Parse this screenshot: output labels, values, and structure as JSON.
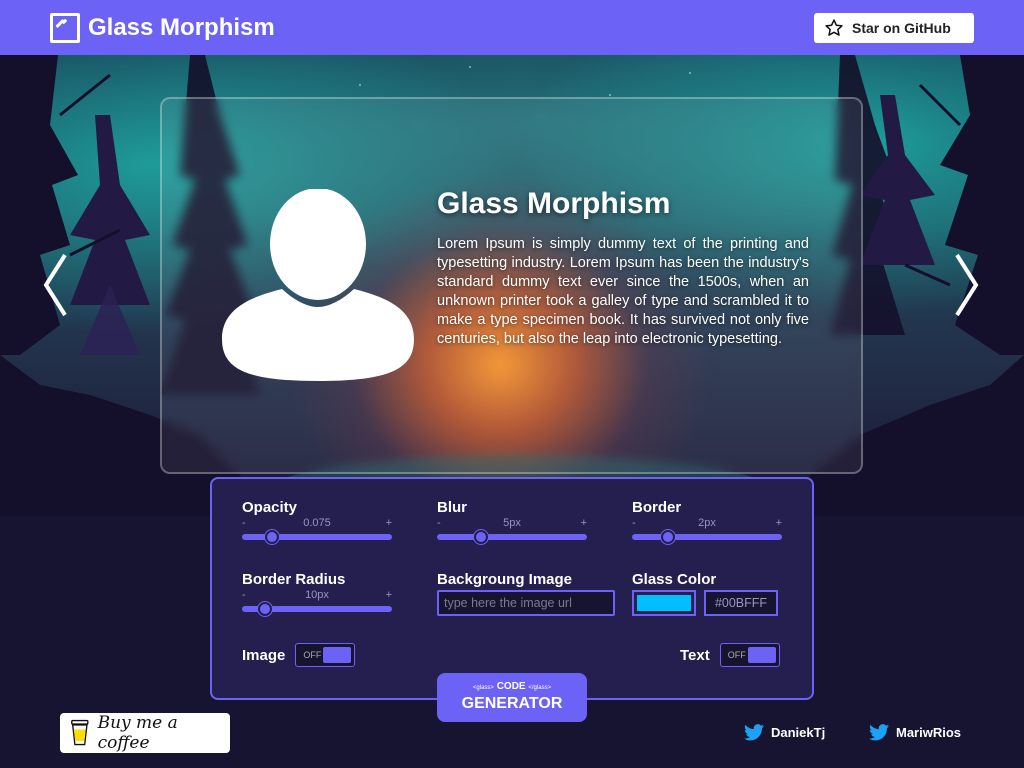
{
  "header": {
    "title": "Glass Morphism",
    "github_label": "Star on GitHub"
  },
  "card": {
    "title": "Glass Morphism",
    "text": "Lorem Ipsum is simply dummy text of the printing and typesetting industry. Lorem Ipsum has been the industry's standard dummy text ever since the 1500s, when an unknown printer took a galley of type and scrambled it to make a type specimen book. It has survived not only five centuries, but also the leap into electronic typesetting."
  },
  "controls": {
    "opacity": {
      "label": "Opacity",
      "minus": "-",
      "plus": "+",
      "value_text": "0.075",
      "fraction": 0.2
    },
    "blur": {
      "label": "Blur",
      "minus": "-",
      "plus": "+",
      "value_text": "5px",
      "fraction": 0.29
    },
    "border": {
      "label": "Border",
      "minus": "-",
      "plus": "+",
      "value_text": "2px",
      "fraction": 0.24
    },
    "border_radius": {
      "label": "Border Radius",
      "minus": "-",
      "plus": "+",
      "value_text": "10px",
      "fraction": 0.15
    },
    "background_image": {
      "label": "Backgroung Image",
      "placeholder": "type here the image url",
      "value": ""
    },
    "glass_color": {
      "label": "Glass Color",
      "hex": "#00BFFF",
      "color": "#00BFFF"
    },
    "image_toggle": {
      "label": "Image",
      "state": "OFF"
    },
    "text_toggle": {
      "label": "Text",
      "state": "OFF"
    }
  },
  "generator": {
    "open_tag": "<glass>",
    "code_label": "CODE",
    "close_tag": "</glass>",
    "button_label": "GENERATOR"
  },
  "footer": {
    "coffee_label": "Buy me a coffee",
    "socials": [
      {
        "name": "DaniekTj",
        "icon": "twitter-icon"
      },
      {
        "name": "MariwRios",
        "icon": "twitter-icon"
      }
    ]
  },
  "colors": {
    "accent": "#6C63F6",
    "panel": "#241F4E",
    "background": "#161431",
    "twitter": "#1DA1F2"
  }
}
